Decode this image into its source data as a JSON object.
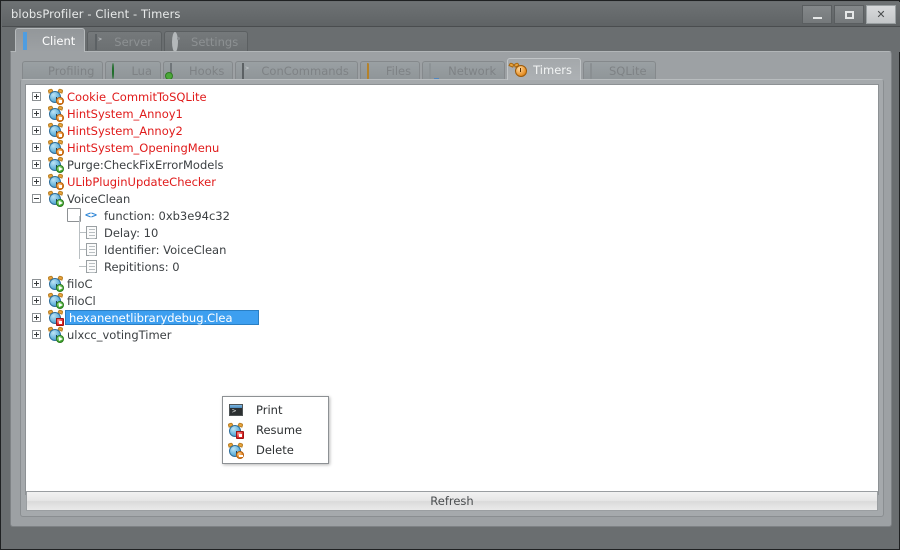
{
  "window": {
    "title": "blobsProfiler - Client - Timers",
    "controls": [
      {
        "name": "minimize",
        "label": "–"
      },
      {
        "name": "maximize",
        "label": "□"
      },
      {
        "name": "close",
        "label": "✕"
      }
    ]
  },
  "outer_tabs": [
    {
      "label": "Client",
      "icon": "monitor-icon",
      "active": true
    },
    {
      "label": "Server",
      "icon": "console-icon",
      "active": false
    },
    {
      "label": "Settings",
      "icon": "gear-icon",
      "active": false
    }
  ],
  "inner_tabs": [
    {
      "label": "Profiling",
      "icon": "hourglass-icon",
      "active": false
    },
    {
      "label": "Lua",
      "icon": "globe-icon",
      "active": false
    },
    {
      "label": "Hooks",
      "icon": "hooks-icon",
      "active": false
    },
    {
      "label": "ConCommands",
      "icon": "console-icon",
      "active": false
    },
    {
      "label": "Files",
      "icon": "folder-icon",
      "active": false
    },
    {
      "label": "Network",
      "icon": "network-icon",
      "active": false
    },
    {
      "label": "Timers",
      "icon": "alarm-clock-icon",
      "active": true
    },
    {
      "label": "SQLite",
      "icon": "database-icon",
      "active": false
    }
  ],
  "tree": {
    "rows": [
      {
        "label": "Cookie_CommitToSQLite",
        "state": "paused",
        "expanded": false,
        "selected": false
      },
      {
        "label": "HintSystem_Annoy1",
        "state": "paused",
        "expanded": false,
        "selected": false
      },
      {
        "label": "HintSystem_Annoy2",
        "state": "paused",
        "expanded": false,
        "selected": false
      },
      {
        "label": "HintSystem_OpeningMenu",
        "state": "paused",
        "expanded": false,
        "selected": false
      },
      {
        "label": "Purge:CheckFixErrorModels",
        "state": "running",
        "expanded": false,
        "selected": false
      },
      {
        "label": "ULibPluginUpdateChecker",
        "state": "paused",
        "expanded": false,
        "selected": false
      },
      {
        "label": "VoiceClean",
        "state": "running",
        "expanded": true,
        "selected": false
      }
    ],
    "children": [
      {
        "label": "function: 0xb3e94c32",
        "icon": "code-icon"
      },
      {
        "label": "Delay: 10",
        "icon": "document-icon"
      },
      {
        "label": "Identifier: VoiceClean",
        "icon": "document-icon"
      },
      {
        "label": "Repititions: 0",
        "icon": "document-icon"
      }
    ],
    "rows_after": [
      {
        "label": "filoC",
        "state": "running",
        "expanded": false,
        "selected": false
      },
      {
        "label": "filoCl",
        "state": "running",
        "expanded": false,
        "selected": false
      },
      {
        "label": "hexanenetlibrarydebug.Clea",
        "state": "stopped",
        "expanded": false,
        "selected": true
      },
      {
        "label": "ulxcc_votingTimer",
        "state": "running",
        "expanded": false,
        "selected": false
      }
    ]
  },
  "context_menu": {
    "items": [
      {
        "label": "Print",
        "icon": "console-icon"
      },
      {
        "label": "Resume",
        "icon": "clock-resume-icon"
      },
      {
        "label": "Delete",
        "icon": "clock-delete-icon"
      }
    ]
  },
  "footer": {
    "refresh_label": "Refresh"
  },
  "colors": {
    "paused_text": "#e01b1b",
    "selection": "#3d9ff0",
    "window_chrome": "#6a6e70",
    "panel": "#a5a9ac"
  }
}
